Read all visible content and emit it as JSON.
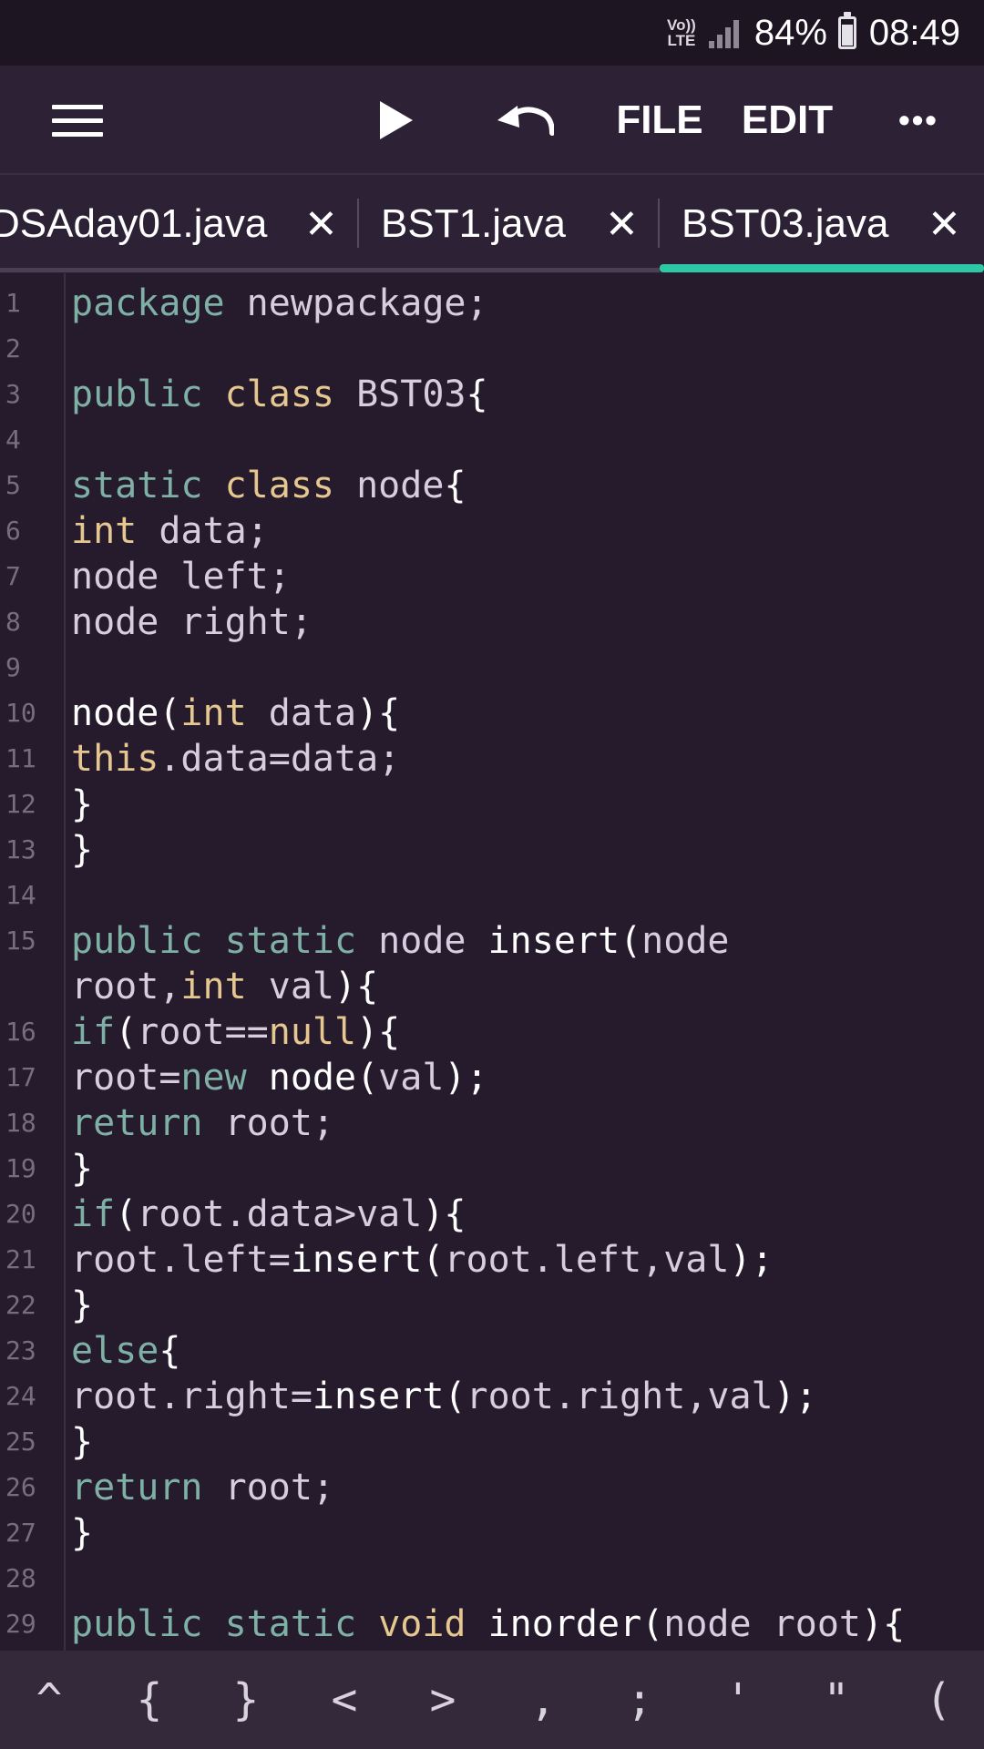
{
  "status_bar": {
    "volte_top": "Vo))",
    "volte_bottom": "LTE",
    "battery": "84%",
    "time": "08:49"
  },
  "toolbar": {
    "file_label": "FILE",
    "edit_label": "EDIT",
    "more_label": "•••",
    "icons": [
      "menu-icon",
      "run-icon",
      "undo-icon",
      "more-icon"
    ]
  },
  "tabs": [
    {
      "label": "DSAday01.java",
      "close": "✕",
      "active": false
    },
    {
      "label": "BST1.java",
      "close": "✕",
      "active": false
    },
    {
      "label": "BST03.java",
      "close": "✕",
      "active": true
    }
  ],
  "accent_color": "#2dc9a6",
  "editor": {
    "lines": [
      {
        "n": "1",
        "tokens": [
          {
            "t": "package",
            "c": "kw"
          },
          {
            "t": " newpackage;",
            "c": "id"
          }
        ]
      },
      {
        "n": "2",
        "tokens": []
      },
      {
        "n": "3",
        "tokens": [
          {
            "t": "public",
            "c": "kw"
          },
          {
            "t": " ",
            "c": "pl"
          },
          {
            "t": "class",
            "c": "ty"
          },
          {
            "t": " BST03",
            "c": "id"
          },
          {
            "t": "{",
            "c": "pl"
          }
        ]
      },
      {
        "n": "4",
        "tokens": []
      },
      {
        "n": "5",
        "tokens": [
          {
            "t": "static",
            "c": "kw"
          },
          {
            "t": " ",
            "c": "pl"
          },
          {
            "t": "class",
            "c": "ty"
          },
          {
            "t": " node",
            "c": "id"
          },
          {
            "t": "{",
            "c": "pl"
          }
        ]
      },
      {
        "n": "6",
        "tokens": [
          {
            "t": "int",
            "c": "ty"
          },
          {
            "t": " data;",
            "c": "id"
          }
        ]
      },
      {
        "n": "7",
        "tokens": [
          {
            "t": "node left;",
            "c": "id"
          }
        ]
      },
      {
        "n": "8",
        "tokens": [
          {
            "t": "node right;",
            "c": "id"
          }
        ]
      },
      {
        "n": "9",
        "tokens": []
      },
      {
        "n": "10",
        "tokens": [
          {
            "t": "node(",
            "c": "pl"
          },
          {
            "t": "int",
            "c": "ty"
          },
          {
            "t": " data",
            "c": "id"
          },
          {
            "t": "){",
            "c": "pl"
          }
        ]
      },
      {
        "n": "11",
        "tokens": [
          {
            "t": "this",
            "c": "ty"
          },
          {
            "t": ".data=data;",
            "c": "id"
          }
        ]
      },
      {
        "n": "12",
        "tokens": [
          {
            "t": "}",
            "c": "pl"
          }
        ]
      },
      {
        "n": "13",
        "tokens": [
          {
            "t": "}",
            "c": "pl"
          }
        ]
      },
      {
        "n": "14",
        "tokens": []
      },
      {
        "n": "15",
        "tokens": [
          {
            "t": "public",
            "c": "kw"
          },
          {
            "t": " ",
            "c": "pl"
          },
          {
            "t": "static",
            "c": "kw"
          },
          {
            "t": " node ",
            "c": "id"
          },
          {
            "t": "insert(",
            "c": "pl"
          },
          {
            "t": "node",
            "c": "id"
          }
        ]
      },
      {
        "n": "",
        "tokens": [
          {
            "t": "root,",
            "c": "id"
          },
          {
            "t": "int",
            "c": "ty"
          },
          {
            "t": " val",
            "c": "id"
          },
          {
            "t": "){",
            "c": "pl"
          }
        ]
      },
      {
        "n": "16",
        "tokens": [
          {
            "t": "if",
            "c": "kw"
          },
          {
            "t": "(",
            "c": "pl"
          },
          {
            "t": "root==",
            "c": "id"
          },
          {
            "t": "null",
            "c": "ty"
          },
          {
            "t": "){",
            "c": "pl"
          }
        ]
      },
      {
        "n": "17",
        "tokens": [
          {
            "t": "root=",
            "c": "id"
          },
          {
            "t": "new",
            "c": "kw"
          },
          {
            "t": " node(",
            "c": "pl"
          },
          {
            "t": "val",
            "c": "id"
          },
          {
            "t": ");",
            "c": "pl"
          }
        ]
      },
      {
        "n": "18",
        "tokens": [
          {
            "t": "return",
            "c": "kw"
          },
          {
            "t": " root;",
            "c": "id"
          }
        ]
      },
      {
        "n": "19",
        "tokens": [
          {
            "t": "}",
            "c": "pl"
          }
        ]
      },
      {
        "n": "20",
        "tokens": [
          {
            "t": "if",
            "c": "kw"
          },
          {
            "t": "(",
            "c": "pl"
          },
          {
            "t": "root.data>val",
            "c": "id"
          },
          {
            "t": "){",
            "c": "pl"
          }
        ]
      },
      {
        "n": "21",
        "tokens": [
          {
            "t": "root.left=",
            "c": "id"
          },
          {
            "t": "insert(",
            "c": "pl"
          },
          {
            "t": "root.left,val",
            "c": "id"
          },
          {
            "t": ");",
            "c": "pl"
          }
        ]
      },
      {
        "n": "22",
        "tokens": [
          {
            "t": "}",
            "c": "pl"
          }
        ]
      },
      {
        "n": "23",
        "tokens": [
          {
            "t": "else",
            "c": "kw"
          },
          {
            "t": "{",
            "c": "pl"
          }
        ]
      },
      {
        "n": "24",
        "tokens": [
          {
            "t": "root.right=",
            "c": "id"
          },
          {
            "t": "insert(",
            "c": "pl"
          },
          {
            "t": "root.right,val",
            "c": "id"
          },
          {
            "t": ");",
            "c": "pl"
          }
        ]
      },
      {
        "n": "25",
        "tokens": [
          {
            "t": "}",
            "c": "pl"
          }
        ]
      },
      {
        "n": "26",
        "tokens": [
          {
            "t": "return",
            "c": "kw"
          },
          {
            "t": " root;",
            "c": "id"
          }
        ]
      },
      {
        "n": "27",
        "tokens": [
          {
            "t": "}",
            "c": "pl"
          }
        ]
      },
      {
        "n": "28",
        "tokens": []
      },
      {
        "n": "29",
        "tokens": [
          {
            "t": "public",
            "c": "kw"
          },
          {
            "t": " ",
            "c": "pl"
          },
          {
            "t": "static",
            "c": "kw"
          },
          {
            "t": " ",
            "c": "pl"
          },
          {
            "t": "void",
            "c": "ty"
          },
          {
            "t": " inorder(",
            "c": "pl"
          },
          {
            "t": "node root",
            "c": "id"
          },
          {
            "t": "){",
            "c": "pl"
          }
        ]
      }
    ]
  },
  "keybar": {
    "keys": [
      "^",
      "{",
      "}",
      "<",
      ">",
      ",",
      ";",
      "'",
      "\"",
      "("
    ]
  }
}
